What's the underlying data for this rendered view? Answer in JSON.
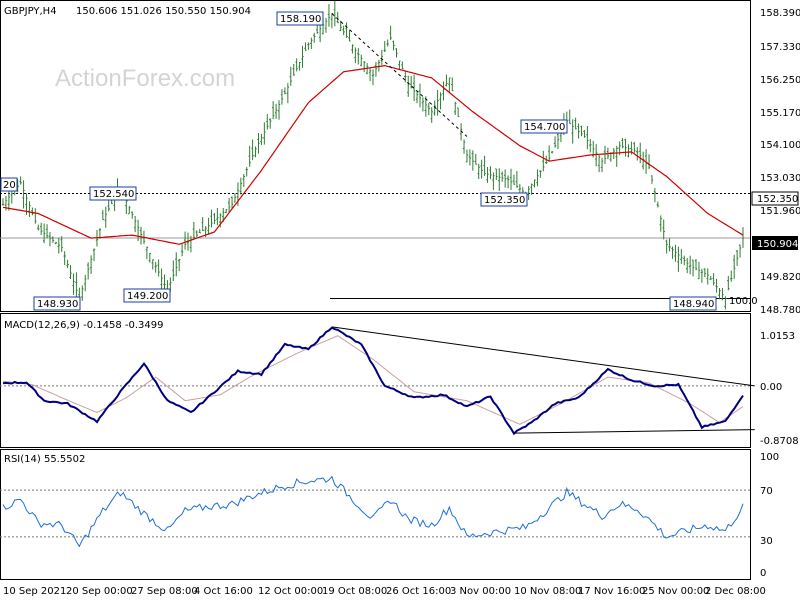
{
  "header": {
    "symbol": "GBPJPY,H4",
    "ohlc": "150.606 151.026 150.550 150.904"
  },
  "watermark": "ActionForex.com",
  "colors": {
    "candles": "#2e7d32",
    "ma": "#d00000",
    "macd": "#000080",
    "signal": "#c8a0a0",
    "rsi": "#1e6fd9",
    "levels": "#000000",
    "trend": "#000000"
  },
  "price_axis_labels": [
    "158.390",
    "157.330",
    "156.250",
    "155.170",
    "154.100",
    "153.030",
    "151.960",
    "150.904",
    "149.820",
    "148.780"
  ],
  "x_labels": [
    "10 Sep 2021",
    "20 Sep 00:00",
    "27 Sep 08:00",
    "4 Oct 16:00",
    "12 Oct 00:00",
    "19 Oct 08:00",
    "26 Oct 16:00",
    "3 Nov 00:00",
    "10 Nov 08:00",
    "17 Nov 16:00",
    "25 Nov 00:00",
    "2 Dec 08:00"
  ],
  "annotations": {
    "left_cut": "20",
    "level_152540": "152.540",
    "level_158190": "158.190",
    "level_154700": "154.700",
    "level_152350": "152.350",
    "level_148930": "148.930",
    "level_149200": "149.200",
    "level_148940": "148.940",
    "hline_tag": "152.350",
    "current_tag": "150.904",
    "fib_tag": "100.0"
  },
  "macd_panel": {
    "title": "MACD(12,26,9) -0.1458 -0.3499",
    "axis_labels": [
      "1.0153",
      "0.00",
      "-0.8708"
    ]
  },
  "rsi_panel": {
    "title": "RSI(14) 55.5502",
    "axis_labels": [
      "100",
      "70",
      "30",
      "0"
    ]
  },
  "chart_data": {
    "type": "line",
    "title": "GBPJPY,H4",
    "price": {
      "ylim": [
        148.6,
        158.5
      ],
      "anchors": [
        {
          "bar": 0,
          "v": 152.0
        },
        {
          "bar": 6,
          "v": 152.7
        },
        {
          "bar": 12,
          "v": 151.2
        },
        {
          "bar": 20,
          "v": 150.6
        },
        {
          "bar": 26,
          "v": 148.93
        },
        {
          "bar": 34,
          "v": 151.5
        },
        {
          "bar": 40,
          "v": 152.54
        },
        {
          "bar": 48,
          "v": 150.8
        },
        {
          "bar": 56,
          "v": 149.2
        },
        {
          "bar": 62,
          "v": 150.7
        },
        {
          "bar": 70,
          "v": 151.3
        },
        {
          "bar": 78,
          "v": 152.0
        },
        {
          "bar": 86,
          "v": 153.8
        },
        {
          "bar": 96,
          "v": 155.6
        },
        {
          "bar": 104,
          "v": 157.2
        },
        {
          "bar": 112,
          "v": 158.19
        },
        {
          "bar": 120,
          "v": 157.0
        },
        {
          "bar": 126,
          "v": 156.2
        },
        {
          "bar": 132,
          "v": 157.4
        },
        {
          "bar": 138,
          "v": 155.9
        },
        {
          "bar": 146,
          "v": 155.0
        },
        {
          "bar": 152,
          "v": 156.1
        },
        {
          "bar": 158,
          "v": 153.6
        },
        {
          "bar": 164,
          "v": 153.0
        },
        {
          "bar": 172,
          "v": 152.8
        },
        {
          "bar": 178,
          "v": 152.35
        },
        {
          "bar": 186,
          "v": 153.5
        },
        {
          "bar": 192,
          "v": 154.7
        },
        {
          "bar": 198,
          "v": 154.2
        },
        {
          "bar": 204,
          "v": 153.4
        },
        {
          "bar": 210,
          "v": 153.9
        },
        {
          "bar": 216,
          "v": 153.7
        },
        {
          "bar": 220,
          "v": 153.2
        },
        {
          "bar": 226,
          "v": 150.7
        },
        {
          "bar": 234,
          "v": 150.0
        },
        {
          "bar": 240,
          "v": 149.7
        },
        {
          "bar": 246,
          "v": 148.94
        },
        {
          "bar": 252,
          "v": 150.904
        }
      ],
      "ma_anchors": [
        {
          "bar": 0,
          "v": 151.9
        },
        {
          "bar": 12,
          "v": 151.7
        },
        {
          "bar": 30,
          "v": 150.9
        },
        {
          "bar": 44,
          "v": 151.0
        },
        {
          "bar": 60,
          "v": 150.7
        },
        {
          "bar": 72,
          "v": 151.1
        },
        {
          "bar": 88,
          "v": 153.1
        },
        {
          "bar": 104,
          "v": 155.3
        },
        {
          "bar": 116,
          "v": 156.3
        },
        {
          "bar": 130,
          "v": 156.5
        },
        {
          "bar": 146,
          "v": 156.1
        },
        {
          "bar": 160,
          "v": 155.0
        },
        {
          "bar": 176,
          "v": 153.9
        },
        {
          "bar": 186,
          "v": 153.4
        },
        {
          "bar": 200,
          "v": 153.6
        },
        {
          "bar": 214,
          "v": 153.7
        },
        {
          "bar": 226,
          "v": 152.9
        },
        {
          "bar": 240,
          "v": 151.7
        },
        {
          "bar": 252,
          "v": 151.0
        }
      ],
      "levels": [
        152.35,
        150.904,
        148.94
      ],
      "trendline": [
        {
          "bar": 112,
          "v": 158.19
        },
        {
          "bar": 158,
          "v": 154.2
        }
      ]
    },
    "macd": {
      "ylim": [
        -1.0,
        1.15
      ],
      "macd_anchors": [
        {
          "bar": 0,
          "v": 0.05
        },
        {
          "bar": 8,
          "v": 0.06
        },
        {
          "bar": 14,
          "v": -0.25
        },
        {
          "bar": 22,
          "v": -0.3
        },
        {
          "bar": 32,
          "v": -0.6
        },
        {
          "bar": 40,
          "v": -0.1
        },
        {
          "bar": 48,
          "v": 0.38
        },
        {
          "bar": 56,
          "v": -0.25
        },
        {
          "bar": 64,
          "v": -0.45
        },
        {
          "bar": 72,
          "v": -0.1
        },
        {
          "bar": 80,
          "v": 0.25
        },
        {
          "bar": 88,
          "v": 0.2
        },
        {
          "bar": 96,
          "v": 0.7
        },
        {
          "bar": 104,
          "v": 0.62
        },
        {
          "bar": 112,
          "v": 1.0
        },
        {
          "bar": 122,
          "v": 0.7
        },
        {
          "bar": 130,
          "v": 0.0
        },
        {
          "bar": 140,
          "v": -0.2
        },
        {
          "bar": 150,
          "v": -0.15
        },
        {
          "bar": 158,
          "v": -0.35
        },
        {
          "bar": 166,
          "v": -0.18
        },
        {
          "bar": 174,
          "v": -0.8
        },
        {
          "bar": 180,
          "v": -0.62
        },
        {
          "bar": 188,
          "v": -0.3
        },
        {
          "bar": 196,
          "v": -0.2
        },
        {
          "bar": 206,
          "v": 0.28
        },
        {
          "bar": 214,
          "v": 0.1
        },
        {
          "bar": 222,
          "v": 0.0
        },
        {
          "bar": 230,
          "v": 0.02
        },
        {
          "bar": 238,
          "v": -0.7
        },
        {
          "bar": 246,
          "v": -0.6
        },
        {
          "bar": 252,
          "v": -0.15
        }
      ],
      "signal_anchors": [
        {
          "bar": 0,
          "v": 0.08
        },
        {
          "bar": 10,
          "v": 0.02
        },
        {
          "bar": 20,
          "v": -0.2
        },
        {
          "bar": 32,
          "v": -0.45
        },
        {
          "bar": 42,
          "v": -0.2
        },
        {
          "bar": 52,
          "v": 0.15
        },
        {
          "bar": 62,
          "v": -0.25
        },
        {
          "bar": 74,
          "v": -0.15
        },
        {
          "bar": 84,
          "v": 0.15
        },
        {
          "bar": 100,
          "v": 0.55
        },
        {
          "bar": 114,
          "v": 0.85
        },
        {
          "bar": 126,
          "v": 0.45
        },
        {
          "bar": 140,
          "v": -0.1
        },
        {
          "bar": 158,
          "v": -0.25
        },
        {
          "bar": 176,
          "v": -0.65
        },
        {
          "bar": 190,
          "v": -0.3
        },
        {
          "bar": 206,
          "v": 0.15
        },
        {
          "bar": 220,
          "v": 0.05
        },
        {
          "bar": 234,
          "v": -0.3
        },
        {
          "bar": 244,
          "v": -0.62
        },
        {
          "bar": 252,
          "v": -0.35
        }
      ],
      "trendlines": [
        [
          {
            "bar": 112,
            "v": 1.0
          },
          {
            "bar": 256,
            "v": 0.0
          }
        ],
        [
          {
            "bar": 174,
            "v": -0.8
          },
          {
            "bar": 256,
            "v": -0.74
          }
        ]
      ]
    },
    "rsi": {
      "ylim": [
        0,
        100
      ],
      "levels": [
        30,
        70
      ],
      "anchors": [
        {
          "bar": 0,
          "v": 55
        },
        {
          "bar": 6,
          "v": 62
        },
        {
          "bar": 12,
          "v": 42
        },
        {
          "bar": 20,
          "v": 40
        },
        {
          "bar": 26,
          "v": 22
        },
        {
          "bar": 34,
          "v": 52
        },
        {
          "bar": 40,
          "v": 68
        },
        {
          "bar": 48,
          "v": 50
        },
        {
          "bar": 56,
          "v": 35
        },
        {
          "bar": 62,
          "v": 52
        },
        {
          "bar": 70,
          "v": 56
        },
        {
          "bar": 78,
          "v": 58
        },
        {
          "bar": 86,
          "v": 66
        },
        {
          "bar": 96,
          "v": 74
        },
        {
          "bar": 104,
          "v": 78
        },
        {
          "bar": 112,
          "v": 80
        },
        {
          "bar": 120,
          "v": 60
        },
        {
          "bar": 126,
          "v": 45
        },
        {
          "bar": 132,
          "v": 62
        },
        {
          "bar": 138,
          "v": 45
        },
        {
          "bar": 146,
          "v": 40
        },
        {
          "bar": 152,
          "v": 55
        },
        {
          "bar": 158,
          "v": 30
        },
        {
          "bar": 164,
          "v": 33
        },
        {
          "bar": 172,
          "v": 36
        },
        {
          "bar": 178,
          "v": 38
        },
        {
          "bar": 186,
          "v": 55
        },
        {
          "bar": 192,
          "v": 68
        },
        {
          "bar": 198,
          "v": 58
        },
        {
          "bar": 204,
          "v": 48
        },
        {
          "bar": 210,
          "v": 58
        },
        {
          "bar": 216,
          "v": 54
        },
        {
          "bar": 220,
          "v": 45
        },
        {
          "bar": 226,
          "v": 30
        },
        {
          "bar": 234,
          "v": 36
        },
        {
          "bar": 240,
          "v": 40
        },
        {
          "bar": 246,
          "v": 35
        },
        {
          "bar": 252,
          "v": 55.55
        }
      ]
    },
    "x_count": 253
  }
}
